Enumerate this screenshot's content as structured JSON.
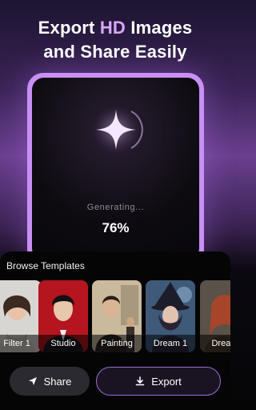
{
  "headline": {
    "line1_prefix": "Export ",
    "line1_highlight": "HD",
    "line1_suffix": " Images",
    "line2": "and Share Easily"
  },
  "generating": {
    "status_text": "Generating...",
    "progress_label": "76%",
    "progress": 0.76
  },
  "templates": {
    "title": "Browse Templates",
    "items": [
      {
        "label": "Filter 1",
        "icon": "portrait-thumbnail"
      },
      {
        "label": "Studio",
        "icon": "portrait-thumbnail"
      },
      {
        "label": "Painting",
        "icon": "portrait-thumbnail"
      },
      {
        "label": "Dream 1",
        "icon": "portrait-thumbnail"
      },
      {
        "label": "Dream",
        "icon": "portrait-thumbnail"
      }
    ]
  },
  "actions": {
    "share_label": "Share",
    "export_label": "Export"
  },
  "colors": {
    "accent": "#c890f4",
    "highlight": "#d9a7ff",
    "export_border": "#9b6fd6"
  }
}
